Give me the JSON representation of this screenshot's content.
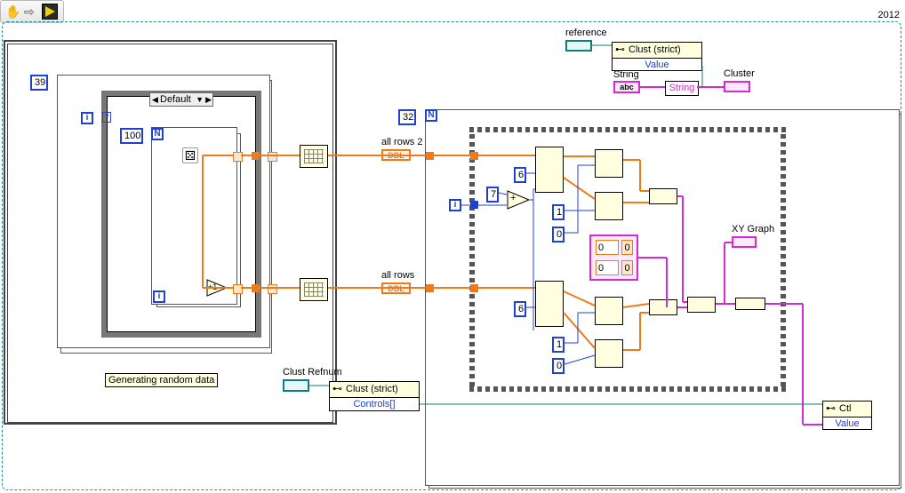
{
  "version_label": "2012",
  "toolbar": {
    "run_tool": "hand-tool-icon",
    "step_tool": "arrow-icon",
    "run_arrow": "run-arrow-icon"
  },
  "constants": {
    "outer_loop_n": "39",
    "inner_loop_n": "100",
    "right_loop_n": "32",
    "c6a": "6",
    "c7": "7",
    "c1a": "1",
    "c0a": "0",
    "c6b": "6",
    "c1b": "1",
    "c0b": "0"
  },
  "case_selector": "Default",
  "labels": {
    "all_rows_2": "all rows 2",
    "all_rows": "all rows",
    "reference": "reference",
    "clust_strict_1": "Clust (strict)",
    "value_1": "Value",
    "string_label": "String",
    "string_node": "String",
    "cluster": "Cluster",
    "xy_graph": "XY Graph",
    "clust_refnum": "Clust Refnum",
    "clust_strict_2": "Clust (strict)",
    "controls": "Controls[]",
    "ctl": "Ctl",
    "value_2": "Value",
    "comment": "Generating random data",
    "iter_i": "i",
    "dbl": "DBL",
    "str_tag": "abc",
    "plus": "+",
    "plus_one": "+1",
    "zero": "0"
  }
}
